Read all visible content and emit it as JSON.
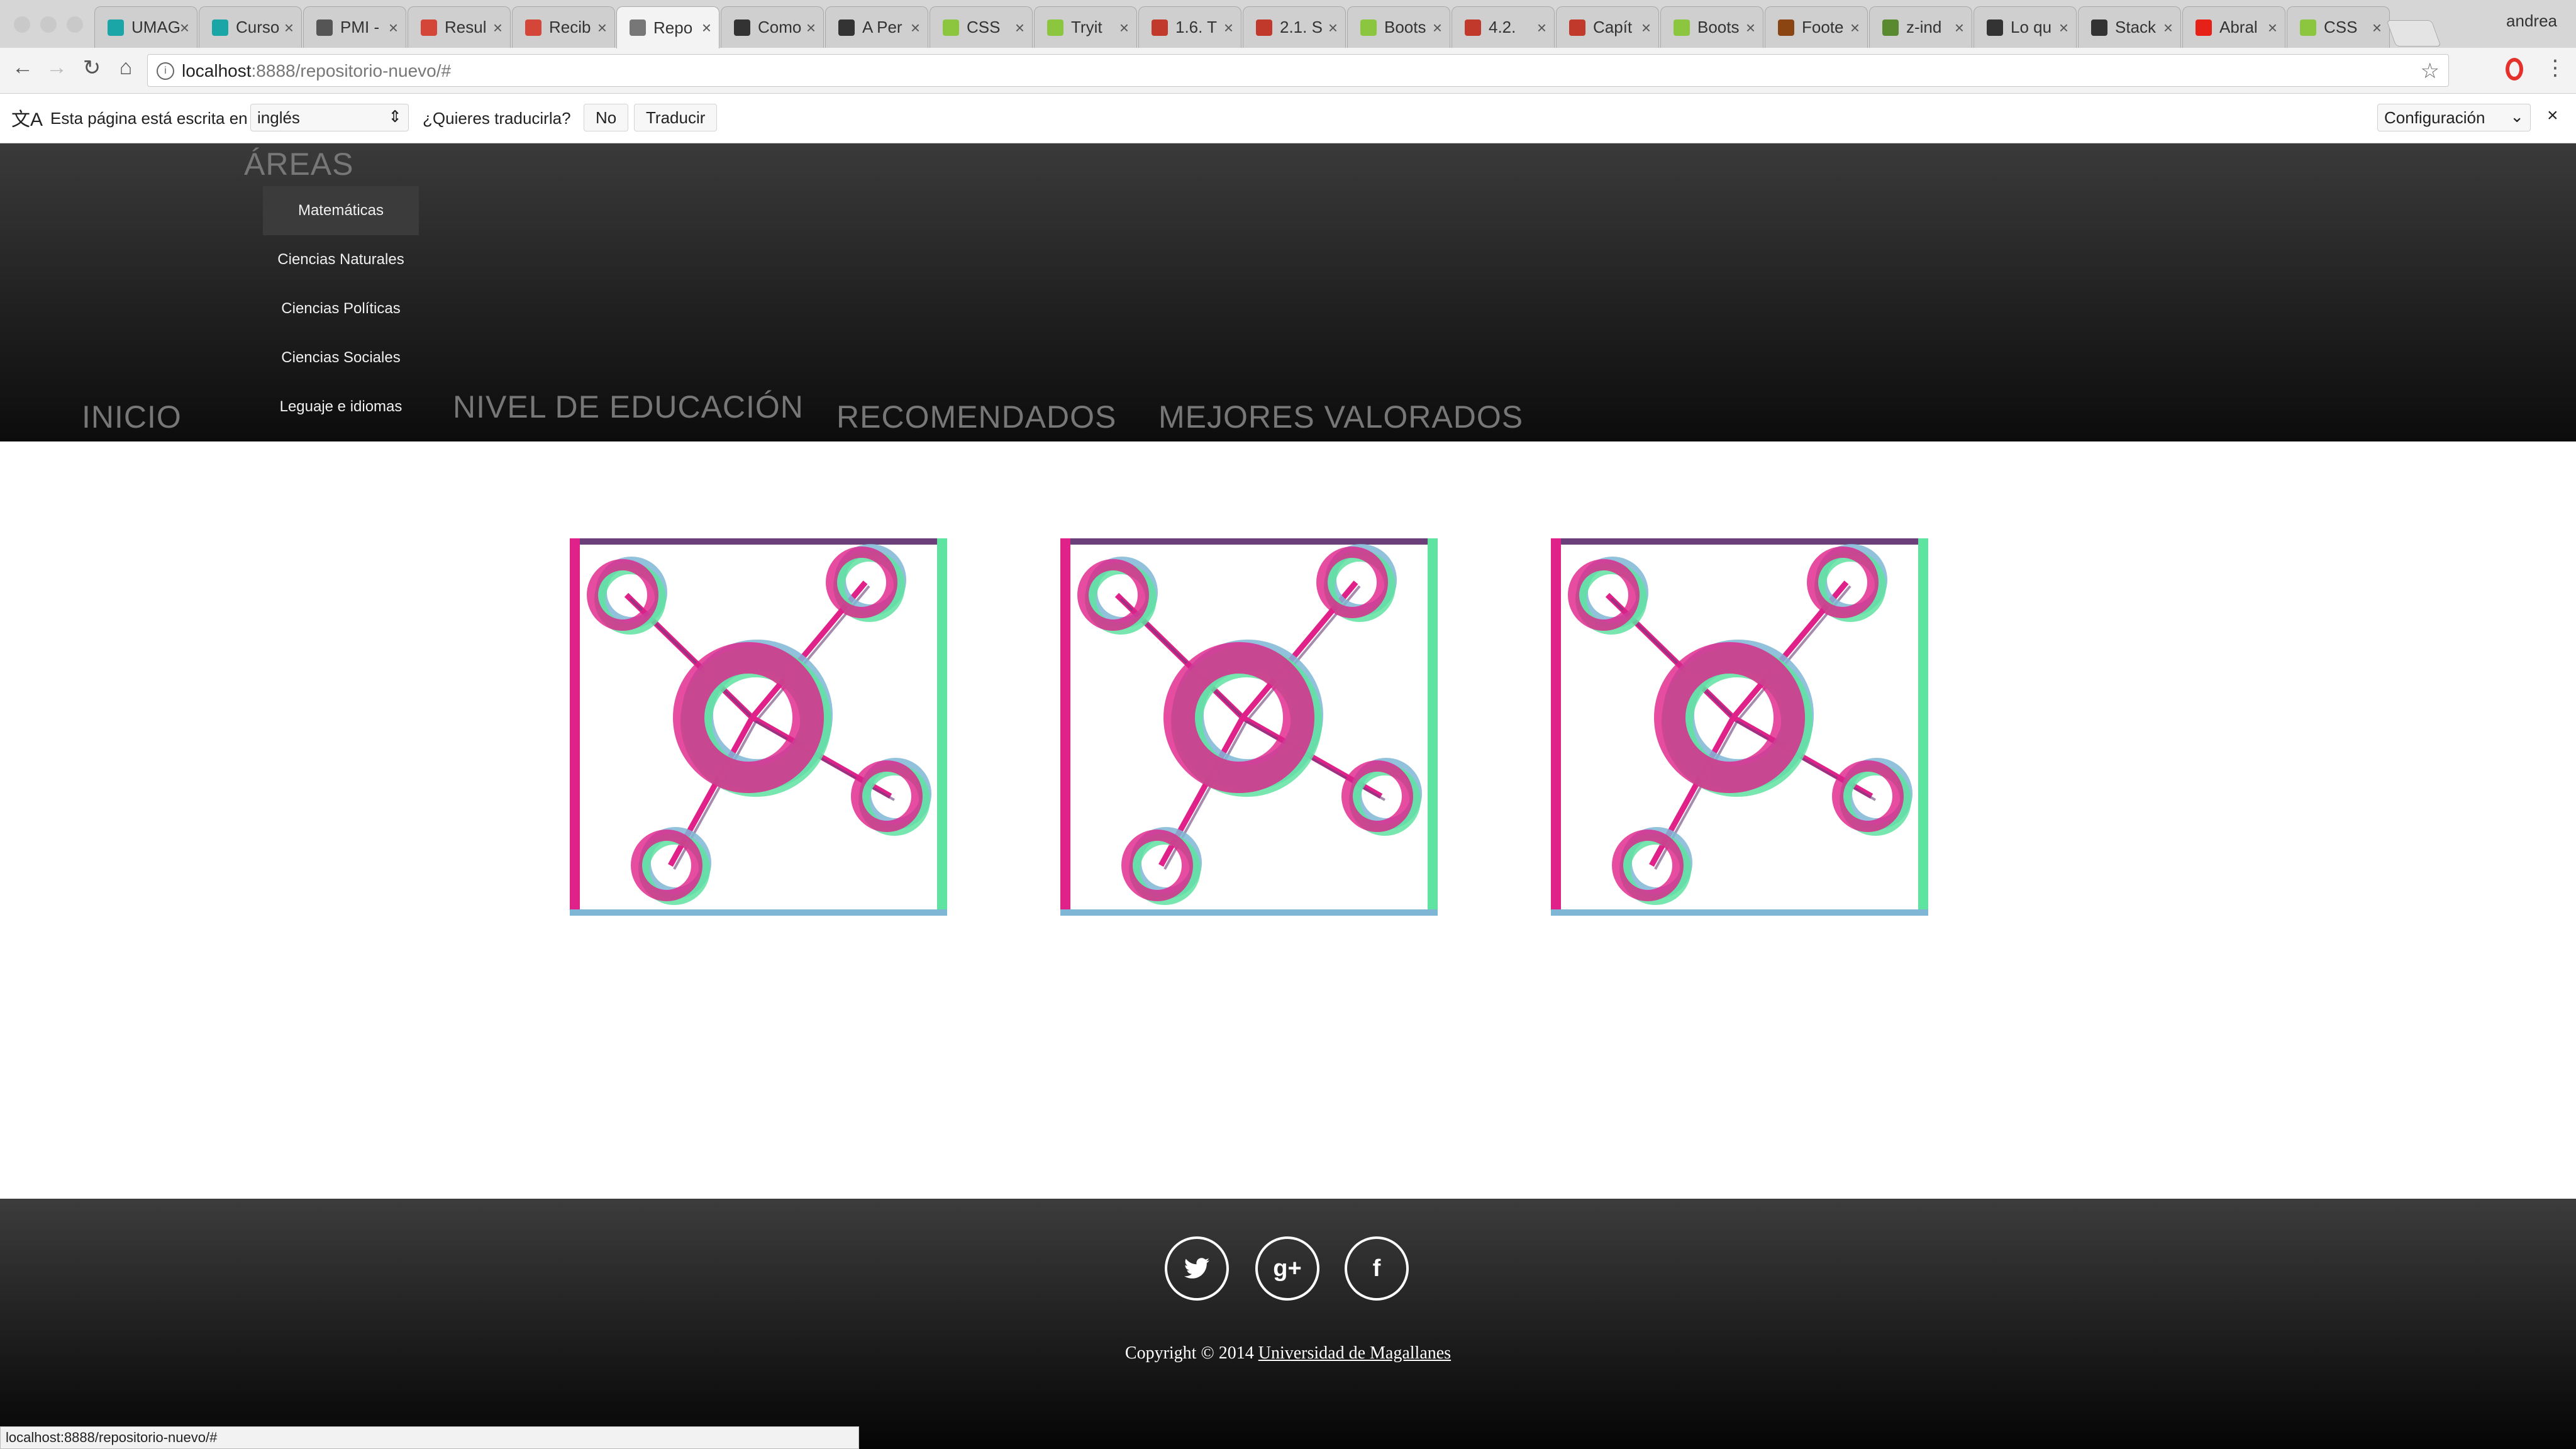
{
  "browser": {
    "tabs": [
      {
        "label": "UMAG",
        "color": "#1aa6a6"
      },
      {
        "label": "Curso",
        "color": "#1aa6a6"
      },
      {
        "label": "PMI -",
        "color": "#555555"
      },
      {
        "label": "Resul",
        "color": "#d44638"
      },
      {
        "label": "Recib",
        "color": "#d44638"
      },
      {
        "label": "Repo",
        "color": "#777777"
      },
      {
        "label": "Como",
        "color": "#333333"
      },
      {
        "label": "A Per",
        "color": "#333333"
      },
      {
        "label": "CSS",
        "color": "#8cc63f"
      },
      {
        "label": "Tryit",
        "color": "#8cc63f"
      },
      {
        "label": "1.6. T",
        "color": "#c0392b"
      },
      {
        "label": "2.1. S",
        "color": "#c0392b"
      },
      {
        "label": "Boots",
        "color": "#8cc63f"
      },
      {
        "label": "4.2.",
        "color": "#c0392b"
      },
      {
        "label": "Capít",
        "color": "#c0392b"
      },
      {
        "label": "Boots",
        "color": "#8cc63f"
      },
      {
        "label": "Foote",
        "color": "#8b4513"
      },
      {
        "label": "z-ind",
        "color": "#5a8a2f"
      },
      {
        "label": "Lo qu",
        "color": "#333333"
      },
      {
        "label": "Stack",
        "color": "#333333"
      },
      {
        "label": "Abral",
        "color": "#e62117"
      },
      {
        "label": "CSS",
        "color": "#8cc63f"
      }
    ],
    "active_tab_index": 5,
    "profile": "andrea",
    "url_host": "localhost",
    "url_path": ":8888/repositorio-nuevo/#",
    "status_url": "localhost:8888/repositorio-nuevo/#"
  },
  "translate_bar": {
    "prompt": "Esta página está escrita en",
    "language": "inglés",
    "question": "¿Quieres traducirla?",
    "no": "No",
    "translate": "Traducir",
    "settings": "Configuración",
    "close": "×"
  },
  "nav": {
    "areas": "ÁREAS",
    "inicio": "INICIO",
    "nivel": "NIVEL DE EDUCACIÓN",
    "recomendados": "RECOMENDADOS",
    "mejores": "MEJORES VALORADOS",
    "dropdown": [
      "Matemáticas",
      "Ciencias Naturales",
      "Ciencias Políticas",
      "Ciencias Sociales",
      "Leguaje e idiomas"
    ]
  },
  "colors": {
    "pink": "#e0218a",
    "green": "#5fe3a1",
    "blue": "#7fb6d6",
    "purple": "#6a3f7a"
  },
  "footer": {
    "copyright_prefix": "Copyright © 2014 ",
    "university": "Universidad de Magallanes",
    "social": [
      "twitter-icon",
      "google-plus-icon",
      "facebook-icon"
    ]
  }
}
